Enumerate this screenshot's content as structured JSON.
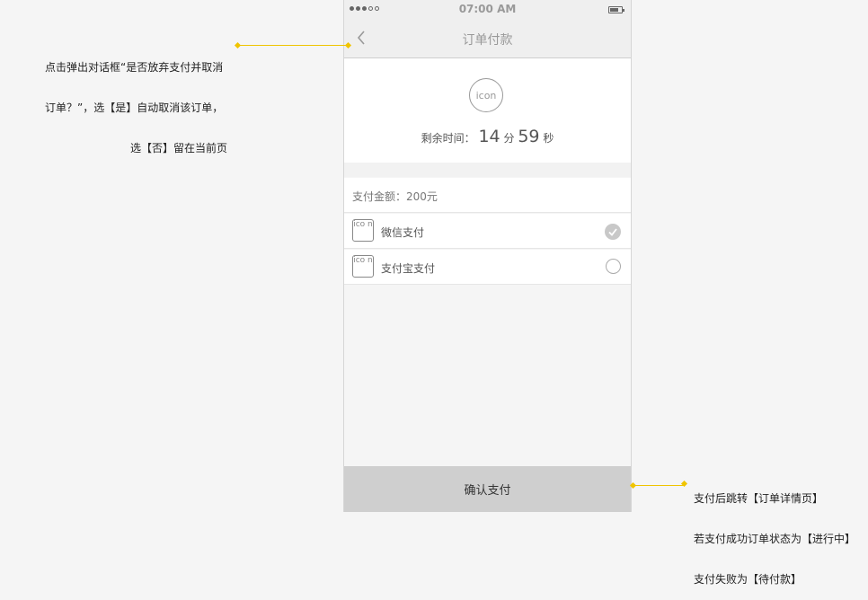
{
  "status_bar": {
    "time": "07:00 AM"
  },
  "nav": {
    "title": "订单付款"
  },
  "timer": {
    "icon_text": "icon",
    "label": "剩余时间：",
    "minutes": "14",
    "minutes_unit": "分",
    "seconds": "59",
    "seconds_unit": "秒"
  },
  "payment": {
    "amount_label": "支付金额：200元",
    "methods": [
      {
        "icon_text": "ico n",
        "label": "微信支付",
        "selected": true
      },
      {
        "icon_text": "ico n",
        "label": "支付宝支付",
        "selected": false
      }
    ],
    "confirm_label": "确认支付"
  },
  "annotations": {
    "back_note": [
      "点击弹出对话框“是否放弃支付并取消",
      "订单？”，选【是】自动取消该订单，",
      "选【否】留在当前页"
    ],
    "confirm_note": [
      "支付后跳转【订单详情页】",
      "若支付成功订单状态为【进行中】",
      "支付失败为【待付款】"
    ]
  },
  "colors": {
    "annotation_line": "#f0c400",
    "confirm_button": "#cfcfcf"
  }
}
